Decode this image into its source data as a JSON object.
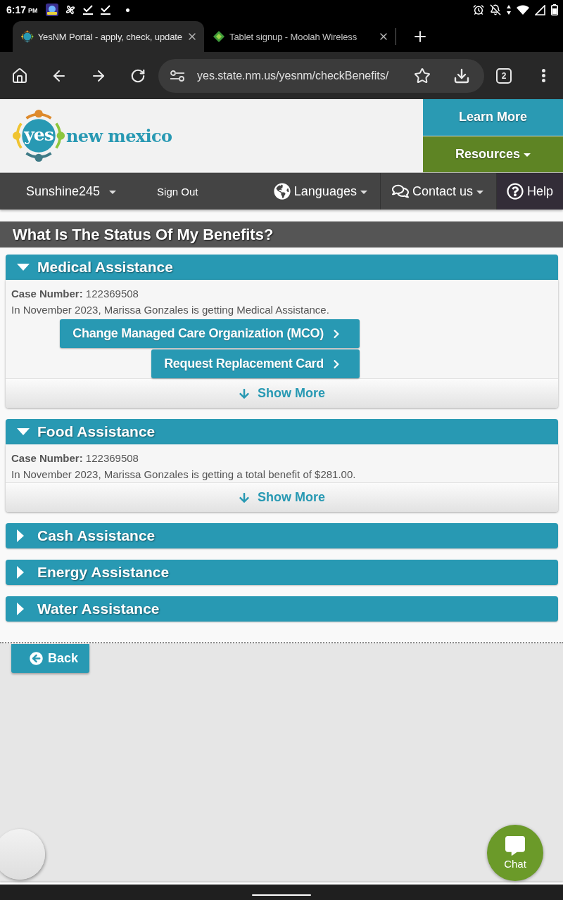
{
  "status_bar": {
    "time": "6:17",
    "period": "PM"
  },
  "browser": {
    "tabs": [
      {
        "title": "YesNM Portal - apply, check, update",
        "selected": true
      },
      {
        "title": "Tablet signup - Moolah Wireless",
        "selected": false
      }
    ],
    "url": "yes.state.nm.us/yesnm/checkBenefits/",
    "tab_count": "2"
  },
  "header": {
    "logo": {
      "mark": "yes",
      "name": "new mexico"
    },
    "buttons": [
      {
        "label": "Learn More",
        "kind": "link"
      },
      {
        "label": "Resources",
        "kind": "menu"
      }
    ]
  },
  "nav": {
    "user": "Sunshine245",
    "sign_out": "Sign Out",
    "items": [
      {
        "label": "Languages",
        "kind": "languages"
      },
      {
        "label": "Contact us",
        "kind": "contact"
      },
      {
        "label": "Help",
        "kind": "help"
      }
    ]
  },
  "page_title": "What Is The Status Of My Benefits?",
  "sections": [
    {
      "title": "Medical Assistance",
      "expanded": true,
      "case_line": "**Case Number:** 122369508",
      "summary": "In November 2023, Marissa Gonzales is getting Medical Assistance.",
      "actions": [
        "Change Managed Care Organization (MCO)",
        "Request Replacement Card"
      ],
      "show_more": "Show More"
    },
    {
      "title": "Food Assistance",
      "expanded": true,
      "case_line": "**Case Number:** 122369508",
      "summary": "In November 2023, Marissa Gonzales is getting a total benefit of $281.00.",
      "show_more": "Show More"
    },
    {
      "title": "Cash Assistance",
      "expanded": false
    },
    {
      "title": "Energy Assistance",
      "expanded": false
    },
    {
      "title": "Water Assistance",
      "expanded": false
    }
  ],
  "back_button": "Back",
  "chat_button": "Chat"
}
